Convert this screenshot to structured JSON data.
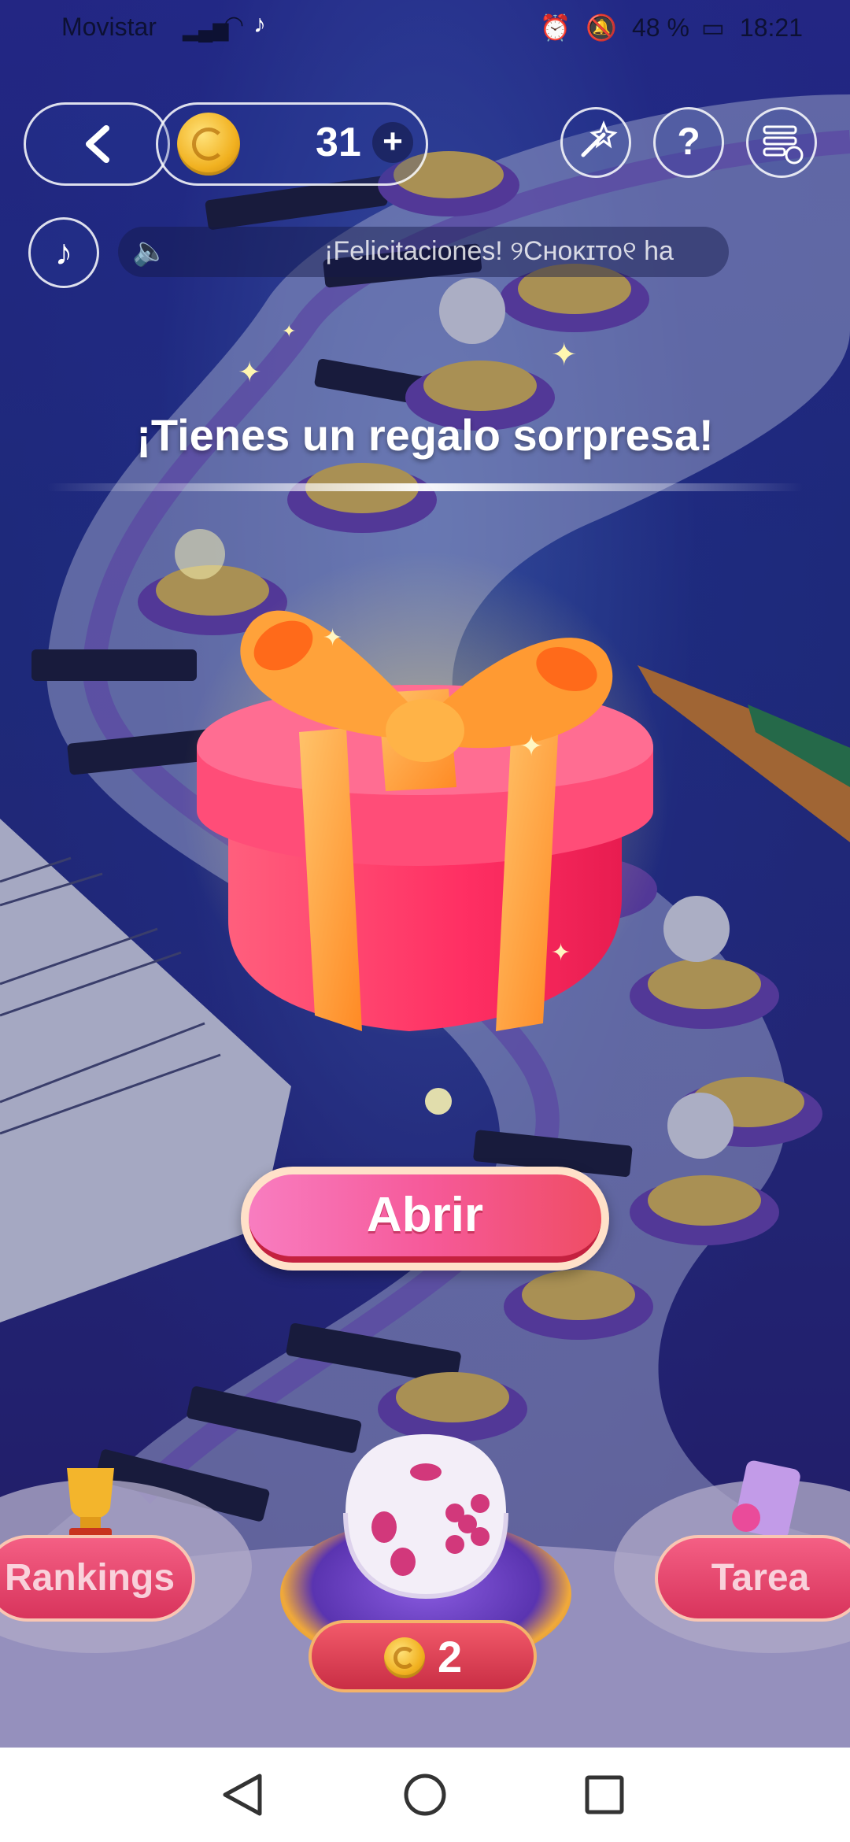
{
  "status_bar": {
    "carrier": "Movistar",
    "battery": "48 %",
    "time": "18:21"
  },
  "top_bar": {
    "coins": "31",
    "plus_label": "+"
  },
  "ticker": {
    "text": "¡Felicitaciones! ୨Cʜᴏᴋɪᴛᴏ୧ ha"
  },
  "popup": {
    "title": "¡Tienes un regalo sorpresa!",
    "open_label": "Abrir"
  },
  "bottom": {
    "rankings_label": "Rankings",
    "task_label": "Tarea",
    "dice_cost": "2"
  },
  "colors": {
    "accent_pink": "#f65a9a",
    "coin_gold": "#f1b120",
    "background_blue": "#2b2f9c"
  }
}
